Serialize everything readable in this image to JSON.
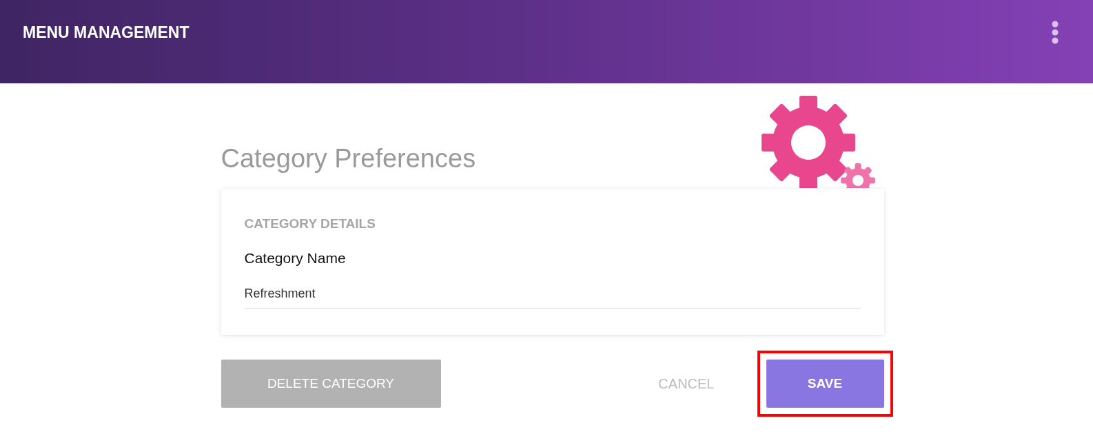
{
  "app_bar": {
    "title": "MENU MANAGEMENT"
  },
  "page_title": "Category Preferences",
  "card": {
    "section_heading": "CATEGORY DETAILS",
    "field": {
      "label": "Category Name",
      "value": "Refreshment"
    }
  },
  "buttons": [
    {
      "kind": "danger",
      "label": "DELETE CATEGORY",
      "disabled": true
    },
    {
      "kind": "text",
      "label": "CANCEL"
    },
    {
      "kind": "primary",
      "label": "SAVE",
      "highlighted": true
    }
  ]
}
